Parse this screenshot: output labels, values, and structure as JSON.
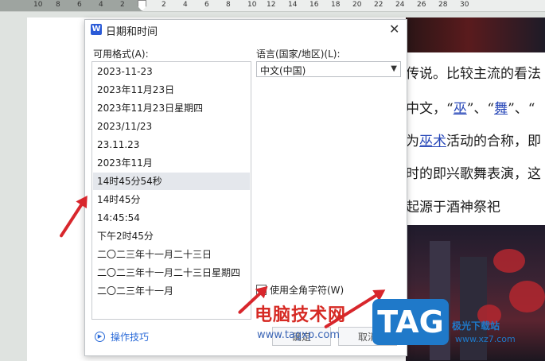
{
  "ruler": {
    "labels": [
      {
        "text": "10"
      },
      {
        "text": "8"
      },
      {
        "text": "6"
      },
      {
        "text": "4"
      },
      {
        "text": "2"
      },
      {
        "text": "2"
      },
      {
        "text": "4"
      },
      {
        "text": "6"
      },
      {
        "text": "8"
      },
      {
        "text": "10"
      },
      {
        "text": "12"
      },
      {
        "text": "14"
      },
      {
        "text": "16"
      },
      {
        "text": "18"
      },
      {
        "text": "20"
      },
      {
        "text": "22"
      },
      {
        "text": "24"
      },
      {
        "text": "26"
      },
      {
        "text": "28"
      },
      {
        "text": "30"
      }
    ]
  },
  "document": {
    "line1": "传说。比较主流的看法",
    "line2_prefix": "中文，“",
    "line2_link1": "巫",
    "line2_mid": "”、“",
    "line2_link2": "舞",
    "line2_suffix": "”、“",
    "line3_prefix": "为",
    "line3_link": "巫术",
    "line3_suffix": "活动的合称，即",
    "line4": "时的即兴歌舞表演，这",
    "line5": "起源于酒神祭祀"
  },
  "dialog": {
    "title": "日期和时间",
    "app_icon_letter": "W",
    "close_symbol": "✕",
    "formats_label": "可用格式(A):",
    "formats": [
      "2023-11-23",
      "2023年11月23日",
      "2023年11月23日星期四",
      "2023/11/23",
      "23.11.23",
      "2023年11月",
      "14时45分54秒",
      "14时45分",
      "14:45:54",
      "下午2时45分",
      "二〇二三年十一月二十三日",
      "二〇二三年十一月二十三日星期四",
      "二〇二三年十一月"
    ],
    "selected_index": 6,
    "language_label": "语言(国家/地区)(L):",
    "language_value": "中文(中国)",
    "fullwidth_label": "使用全角字符(W)",
    "tips_label": "操作技巧",
    "ok_label": "确定",
    "cancel_label": "取消"
  },
  "watermark": {
    "site_name": "电脑技术网",
    "site_url": "www.tagxp.com",
    "logo_text": "TAG",
    "logo_sub1": "极光下载站",
    "logo_sub2": "www.xz7.com"
  },
  "colors": {
    "accent": "#2a6ad8",
    "arrow": "#d8262c",
    "selection": "#e4e7ec",
    "tag_logo": "#1f79c9"
  }
}
